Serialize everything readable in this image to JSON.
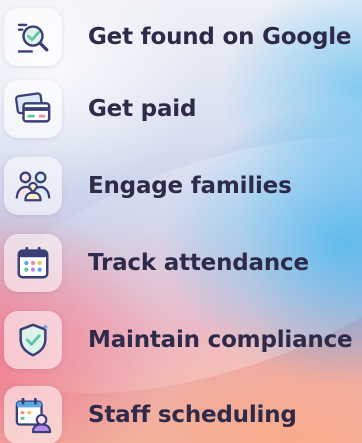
{
  "features": {
    "items": [
      {
        "label": "Get found on Google",
        "icon": "search-magnifier-icon"
      },
      {
        "label": "Get paid",
        "icon": "credit-card-icon"
      },
      {
        "label": "Engage families",
        "icon": "family-group-icon"
      },
      {
        "label": "Track attendance",
        "icon": "calendar-icon"
      },
      {
        "label": "Maintain compliance",
        "icon": "shield-check-icon"
      },
      {
        "label": "Staff scheduling",
        "icon": "staff-calendar-icon"
      }
    ]
  },
  "colors": {
    "label_text": "#2e2a4a",
    "icon_stroke": "#3b3f78",
    "accent_green": "#5fc6a0",
    "accent_blue": "#58a8e8",
    "accent_pink": "#f08aa8"
  }
}
